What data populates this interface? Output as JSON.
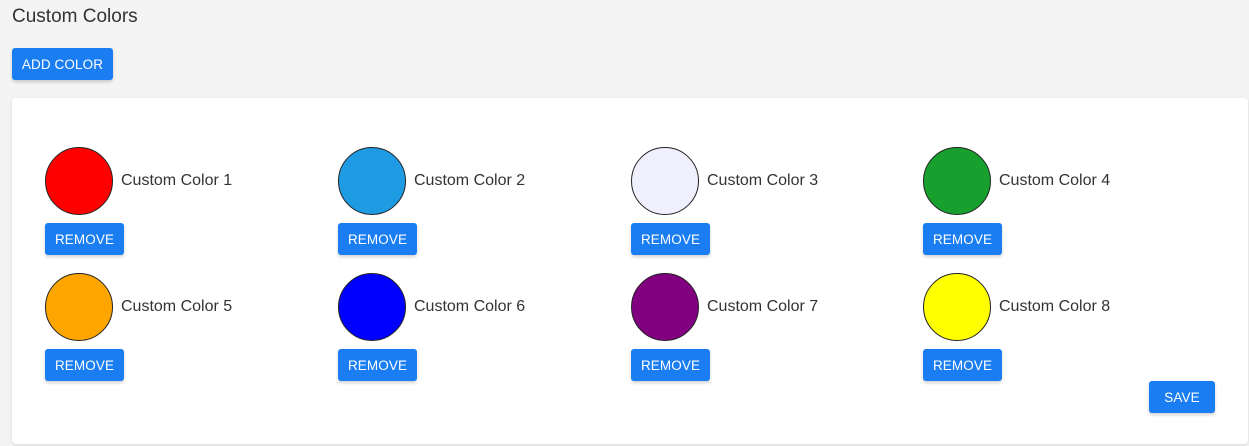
{
  "header": {
    "title": "Custom Colors",
    "add_label": "ADD COLOR"
  },
  "colors": [
    {
      "name": "Custom Color 1",
      "hex": "#ff0000",
      "remove_label": "REMOVE"
    },
    {
      "name": "Custom Color 2",
      "hex": "#1e9be3",
      "remove_label": "REMOVE"
    },
    {
      "name": "Custom Color 3",
      "hex": "#efeffd",
      "remove_label": "REMOVE"
    },
    {
      "name": "Custom Color 4",
      "hex": "#17a02e",
      "remove_label": "REMOVE"
    },
    {
      "name": "Custom Color 5",
      "hex": "#ffa500",
      "remove_label": "REMOVE"
    },
    {
      "name": "Custom Color 6",
      "hex": "#0000ff",
      "remove_label": "REMOVE"
    },
    {
      "name": "Custom Color 7",
      "hex": "#800080",
      "remove_label": "REMOVE"
    },
    {
      "name": "Custom Color 8",
      "hex": "#ffff00",
      "remove_label": "REMOVE"
    }
  ],
  "footer": {
    "save_label": "SAVE"
  },
  "theme": {
    "accent": "#1a7ef2",
    "background": "#f4f4f4",
    "panel": "#ffffff"
  }
}
